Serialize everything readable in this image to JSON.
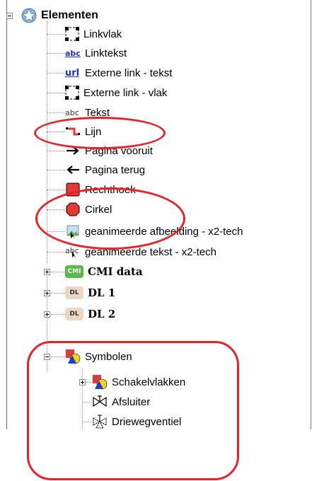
{
  "tree": {
    "root": {
      "label": "Elementen"
    },
    "items": [
      {
        "label": "Linkvlak",
        "icon": "link-area-icon"
      },
      {
        "label": "Linktekst",
        "icon": "link-text-icon",
        "icon_text": "abc"
      },
      {
        "label": "Externe link - tekst",
        "icon": "external-link-text-icon",
        "icon_text": "url"
      },
      {
        "label": "Externe link - vlak",
        "icon": "external-link-area-icon"
      },
      {
        "label": "Tekst",
        "icon": "text-icon",
        "icon_text": "abc"
      },
      {
        "label": "Lijn",
        "icon": "line-icon"
      },
      {
        "label": "Pagina vooruit",
        "icon": "arrow-right-icon"
      },
      {
        "label": "Pagina terug",
        "icon": "arrow-left-icon"
      },
      {
        "label": "Rechthoek",
        "icon": "rectangle-icon"
      },
      {
        "label": "Cirkel",
        "icon": "circle-icon"
      },
      {
        "label": "geanimeerde afbeelding - x2-tech",
        "icon": "animated-image-icon"
      },
      {
        "label": "geanimeerde tekst - x2-tech",
        "icon": "animated-text-icon",
        "icon_text": "abc"
      }
    ],
    "groups": [
      {
        "label": "CMI data",
        "badge": "CMI",
        "expander": "+"
      },
      {
        "label": "DL 1",
        "badge": "DL",
        "expander": "+"
      },
      {
        "label": "DL 2",
        "badge": "DL",
        "expander": "+"
      }
    ],
    "symbolen": {
      "label": "Symbolen",
      "expander": "-",
      "children": [
        {
          "label": "Schakelvlakken",
          "icon": "switch-panels-icon",
          "expander": "+"
        },
        {
          "label": "Afsluiter",
          "icon": "valve-icon"
        },
        {
          "label": "Driewegventiel",
          "icon": "three-way-valve-icon"
        }
      ]
    }
  },
  "colors": {
    "highlight": "#e8212a",
    "rect_fill": "#e53935",
    "link_blue": "#1c2ecc",
    "badge_cmi": "#5bb84a",
    "badge_dl": "#ecd7c6"
  }
}
